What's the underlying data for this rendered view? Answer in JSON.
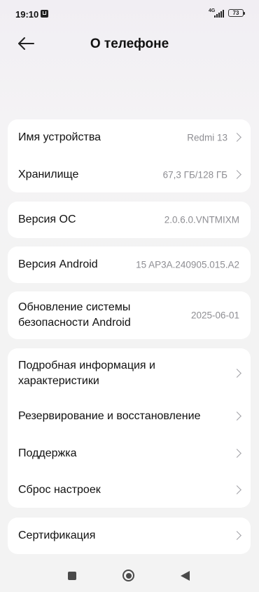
{
  "status_bar": {
    "time": "19:10",
    "network_type": "4G",
    "battery": "73"
  },
  "header": {
    "title": "О телефоне",
    "back_icon": "arrow-left-icon"
  },
  "groups": [
    {
      "items": [
        {
          "label": "Имя устройства",
          "value": "Redmi 13",
          "chevron": true
        },
        {
          "label": "Хранилище",
          "value": "67,3 ГБ/128 ГБ",
          "chevron": true
        }
      ]
    },
    {
      "items": [
        {
          "label": "Версия ОС",
          "value": "2.0.6.0.VNTMIXM",
          "chevron": false
        }
      ]
    },
    {
      "items": [
        {
          "label": "Версия Android",
          "value": "15 AP3A.240905.015.A2",
          "chevron": false
        }
      ]
    },
    {
      "items": [
        {
          "label": "Обновление системы безопасности Android",
          "value": "2025-06-01",
          "chevron": false
        }
      ]
    },
    {
      "items": [
        {
          "label": "Подробная информация и характеристики",
          "chevron": true
        },
        {
          "label": "Резервирование и восстановление",
          "chevron": true
        },
        {
          "label": "Поддержка",
          "chevron": true
        },
        {
          "label": "Сброс настроек",
          "chevron": true
        }
      ]
    },
    {
      "items": [
        {
          "label": "Сертификация",
          "chevron": true
        }
      ]
    }
  ],
  "nav_bar": {
    "recents_icon": "square-icon",
    "home_icon": "circle-icon",
    "back_icon": "triangle-back-icon"
  }
}
